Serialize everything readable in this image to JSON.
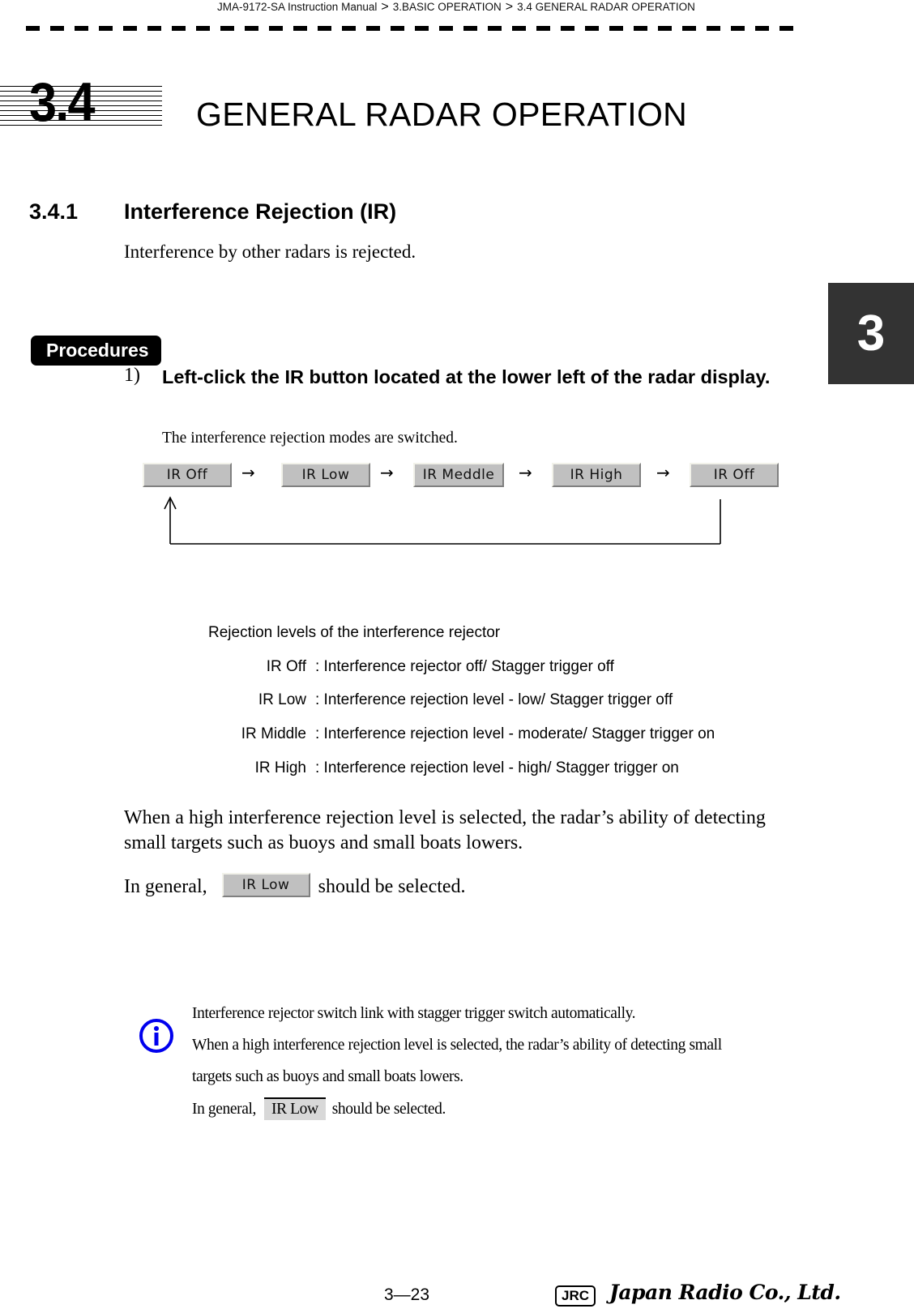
{
  "header": {
    "breadcrumb": [
      "JMA-9172-SA Instruction Manual",
      "3.BASIC OPERATION",
      "3.4  GENERAL RADAR OPERATION"
    ],
    "separator": ">"
  },
  "chapter": {
    "section_number": "3.4",
    "section_title": "GENERAL RADAR OPERATION",
    "chapter_tab": "3"
  },
  "subsection": {
    "number": "3.4.1",
    "title": "Interference Rejection (IR)",
    "intro": "Interference by other radars is rejected."
  },
  "procedures": {
    "badge": "Procedures",
    "steps": [
      {
        "number": "1)",
        "text": "Left-click the  IR  button located at the lower left of the radar display.",
        "result": "The interference rejection modes are switched."
      }
    ]
  },
  "mode_cycle": {
    "buttons": [
      "IR Off",
      "IR Low",
      "IR Meddle",
      "IR High",
      "IR Off"
    ],
    "arrow": "→",
    "return_arrow": "↑"
  },
  "rejection_levels": {
    "title": "Rejection levels of the interference rejector",
    "rows": [
      {
        "label": "IR Off",
        "desc": ": Interference rejector off/ Stagger trigger off"
      },
      {
        "label": "IR Low",
        "desc": ": Interference rejection level - low/ Stagger trigger off"
      },
      {
        "label": "IR Middle",
        "desc": ": Interference rejection level - moderate/ Stagger trigger on"
      },
      {
        "label": "IR High",
        "desc": ": Interference rejection level - high/ Stagger trigger on"
      }
    ]
  },
  "body": {
    "warning_para": "When a high interference rejection level is selected, the radar’s ability of detecting small targets such as buoys and small boats lowers.",
    "general_prefix": "In general,",
    "general_button": "IR Low",
    "general_suffix": "should be selected."
  },
  "note": {
    "icon": "info-icon",
    "icon_color": "#0000ee",
    "lines": [
      "Interference rejector switch link with stagger trigger switch automatically.",
      "When a high interference rejection level is selected, the radar’s ability of detecting small",
      "targets such as buoys and small boats lowers."
    ],
    "general_prefix": "In general,",
    "general_button": "IR Low",
    "general_suffix": "should be selected."
  },
  "footer": {
    "page_number": "3—23",
    "logo_badge": "JRC",
    "company": "Japan Radio Co., Ltd."
  }
}
